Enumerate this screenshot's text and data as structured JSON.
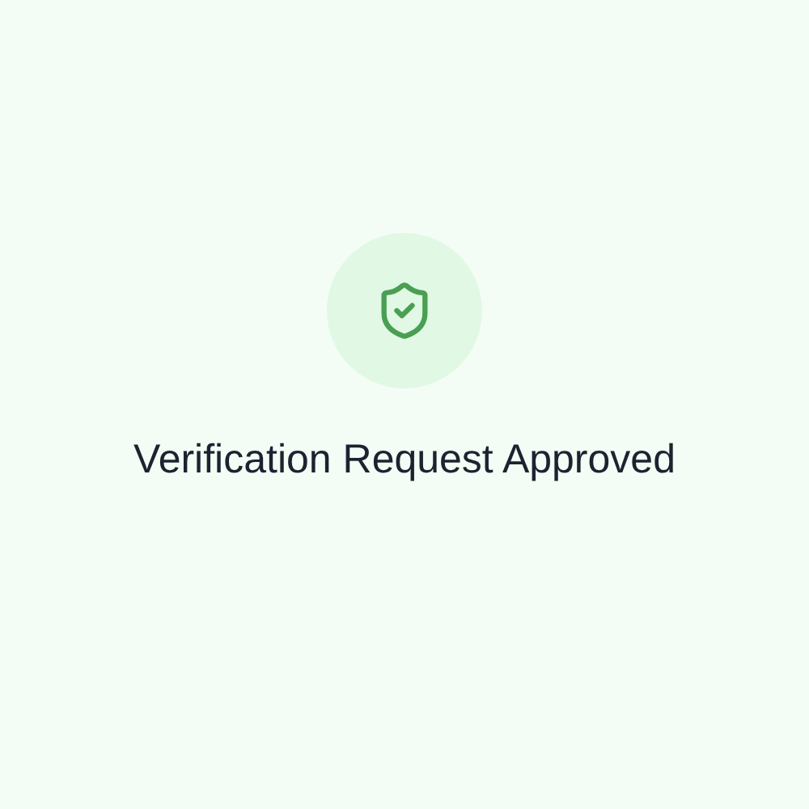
{
  "message": {
    "title": "Verification Request Approved"
  }
}
